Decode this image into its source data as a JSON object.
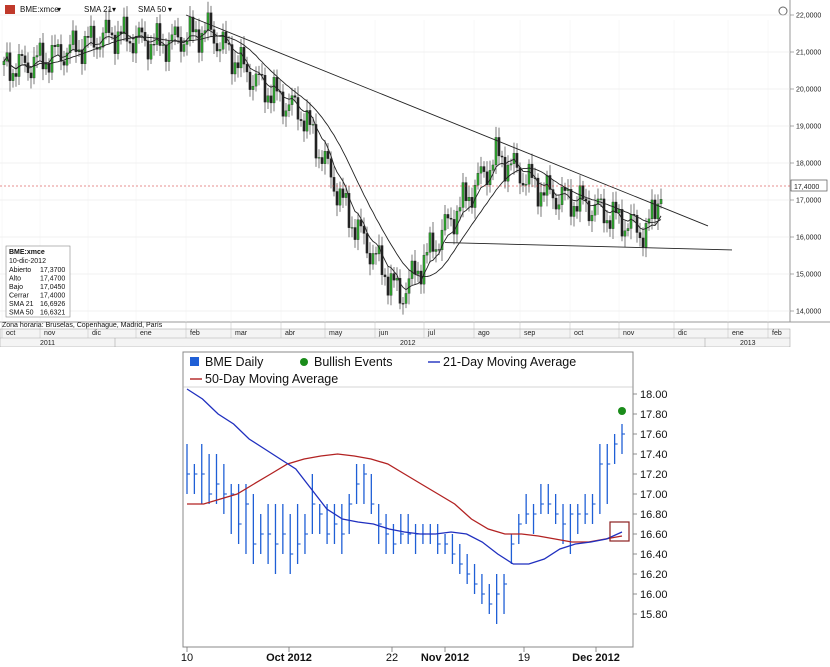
{
  "top_chart": {
    "toolbar": {
      "symbol": "BME:xmce",
      "sma21": "SMA 21",
      "sma50": "SMA 50"
    },
    "price_label": "17,4000",
    "y_ticks": [
      "22,0000",
      "21,0000",
      "20,0000",
      "19,0000",
      "18,0000",
      "17,0000",
      "16,0000",
      "15,0000",
      "14,0000"
    ],
    "months": [
      "oct",
      "nov",
      "dic",
      "ene",
      "feb",
      "mar",
      "abr",
      "may",
      "jun",
      "jul",
      "ago",
      "sep",
      "oct",
      "nov",
      "dic",
      "ene",
      "feb"
    ],
    "years": [
      "2011",
      "2012",
      "2013"
    ],
    "timezone_note": "Zona horaria: Bruselas, Copenhague, Madrid, París",
    "info_box": {
      "title": "BME:xmce",
      "date": "10-dic-2012",
      "rows": [
        {
          "label": "Abierto",
          "value": "17,3700"
        },
        {
          "label": "Alto",
          "value": "17,4700"
        },
        {
          "label": "Bajo",
          "value": "17,0450"
        },
        {
          "label": "Cerrar",
          "value": "17,4000"
        },
        {
          "label": "SMA 21",
          "value": "16,6926"
        },
        {
          "label": "SMA 50",
          "value": "16,6321"
        }
      ]
    }
  },
  "chart_data": [
    {
      "type": "candlestick",
      "title": "",
      "ylim": [
        13.8,
        22.2
      ],
      "y_ticks": [
        22,
        21,
        20,
        19,
        18,
        17,
        16,
        15,
        14
      ],
      "last_close": 17.4,
      "close_path": {
        "months": [
          "oct",
          "nov",
          "dic",
          "ene",
          "feb",
          "mar",
          "abr",
          "may",
          "jun",
          "jul",
          "ago",
          "sep",
          "oct",
          "nov",
          "dic"
        ],
        "approx_close": [
          20.6,
          21.0,
          21.5,
          21.2,
          21.6,
          20.2,
          19.3,
          16.5,
          14.4,
          16.4,
          18.2,
          17.2,
          16.8,
          16.1,
          17.4
        ]
      },
      "series": [
        {
          "name": "SMA 21"
        },
        {
          "name": "SMA 50"
        }
      ]
    },
    {
      "type": "bar",
      "ylim": [
        15.7,
        18.1
      ],
      "y_ticks": [
        "18.00",
        "17.80",
        "17.60",
        "17.40",
        "17.20",
        "17.00",
        "16.80",
        "16.60",
        "16.40",
        "16.20",
        "16.00",
        "15.80"
      ],
      "x_ticks": [
        "10",
        "Oct 2012",
        "22",
        "Nov 2012",
        "19",
        "Dec 2012"
      ],
      "legend": [
        "BME Daily",
        "Bullish Events",
        "21-Day Moving Average",
        "50-Day Moving Average"
      ],
      "bars": [
        [
          17.0,
          17.5,
          17.2
        ],
        [
          17.0,
          17.3,
          17.2
        ],
        [
          16.9,
          17.5,
          17.2
        ],
        [
          16.9,
          17.4,
          17.0
        ],
        [
          16.9,
          17.4,
          17.1
        ],
        [
          16.8,
          17.3,
          17.0
        ],
        [
          16.6,
          17.1,
          17.0
        ],
        [
          16.5,
          17.1,
          16.7
        ],
        [
          16.4,
          17.1,
          16.9
        ],
        [
          16.3,
          17.0,
          16.5
        ],
        [
          16.4,
          16.8,
          16.6
        ],
        [
          16.3,
          16.9,
          16.6
        ],
        [
          16.2,
          16.9,
          16.5
        ],
        [
          16.4,
          16.9,
          16.6
        ],
        [
          16.2,
          16.8,
          16.4
        ],
        [
          16.3,
          16.9,
          16.5
        ],
        [
          16.4,
          16.8,
          16.6
        ],
        [
          16.6,
          17.2,
          16.9
        ],
        [
          16.6,
          16.9,
          16.8
        ],
        [
          16.5,
          16.9,
          16.6
        ],
        [
          16.5,
          16.9,
          16.7
        ],
        [
          16.4,
          16.9,
          16.6
        ],
        [
          16.6,
          17.0,
          16.9
        ],
        [
          16.9,
          17.3,
          17.1
        ],
        [
          16.9,
          17.3,
          17.2
        ],
        [
          16.8,
          17.2,
          16.9
        ],
        [
          16.5,
          16.9,
          16.7
        ],
        [
          16.4,
          16.8,
          16.6
        ],
        [
          16.4,
          16.7,
          16.5
        ],
        [
          16.5,
          16.8,
          16.6
        ],
        [
          16.5,
          16.8,
          16.6
        ],
        [
          16.4,
          16.7,
          16.6
        ],
        [
          16.5,
          16.7,
          16.6
        ],
        [
          16.5,
          16.7,
          16.6
        ],
        [
          16.4,
          16.7,
          16.5
        ],
        [
          16.4,
          16.6,
          16.5
        ],
        [
          16.3,
          16.6,
          16.4
        ],
        [
          16.2,
          16.5,
          16.3
        ],
        [
          16.1,
          16.4,
          16.2
        ],
        [
          16.0,
          16.3,
          16.1
        ],
        [
          15.9,
          16.2,
          16.0
        ],
        [
          15.8,
          16.1,
          15.9
        ],
        [
          15.7,
          16.2,
          16.0
        ],
        [
          15.8,
          16.2,
          16.1
        ],
        [
          16.3,
          16.6,
          16.5
        ],
        [
          16.5,
          16.8,
          16.7
        ],
        [
          16.7,
          17.0,
          16.8
        ],
        [
          16.6,
          16.9,
          16.8
        ],
        [
          16.8,
          17.1,
          16.9
        ],
        [
          16.8,
          17.1,
          16.9
        ],
        [
          16.7,
          17.0,
          16.8
        ],
        [
          16.5,
          16.9,
          16.7
        ],
        [
          16.4,
          16.9,
          16.8
        ],
        [
          16.6,
          16.9,
          16.8
        ],
        [
          16.7,
          17.0,
          16.8
        ],
        [
          16.7,
          17.0,
          16.9
        ],
        [
          16.8,
          17.5,
          17.3
        ],
        [
          16.9,
          17.5,
          17.3
        ],
        [
          17.3,
          17.6,
          17.5
        ],
        [
          17.4,
          17.7,
          17.6
        ]
      ],
      "sma21": [
        18.05,
        17.95,
        17.8,
        17.7,
        17.55,
        17.45,
        17.35,
        17.25,
        17.05,
        16.85,
        16.75,
        16.72,
        16.7,
        16.65,
        16.62,
        16.6,
        16.6,
        16.62,
        16.6,
        16.52,
        16.4,
        16.3,
        16.3,
        16.35,
        16.45,
        16.5,
        16.52,
        16.55,
        16.62
      ],
      "sma50": [
        16.9,
        16.9,
        16.95,
        17.0,
        17.1,
        17.2,
        17.3,
        17.35,
        17.38,
        17.4,
        17.38,
        17.35,
        17.3,
        17.2,
        17.1,
        17.0,
        16.9,
        16.75,
        16.65,
        16.6,
        16.6,
        16.58,
        16.55,
        16.52,
        16.52,
        16.55,
        16.58
      ],
      "bullish_event": 17.83
    }
  ]
}
